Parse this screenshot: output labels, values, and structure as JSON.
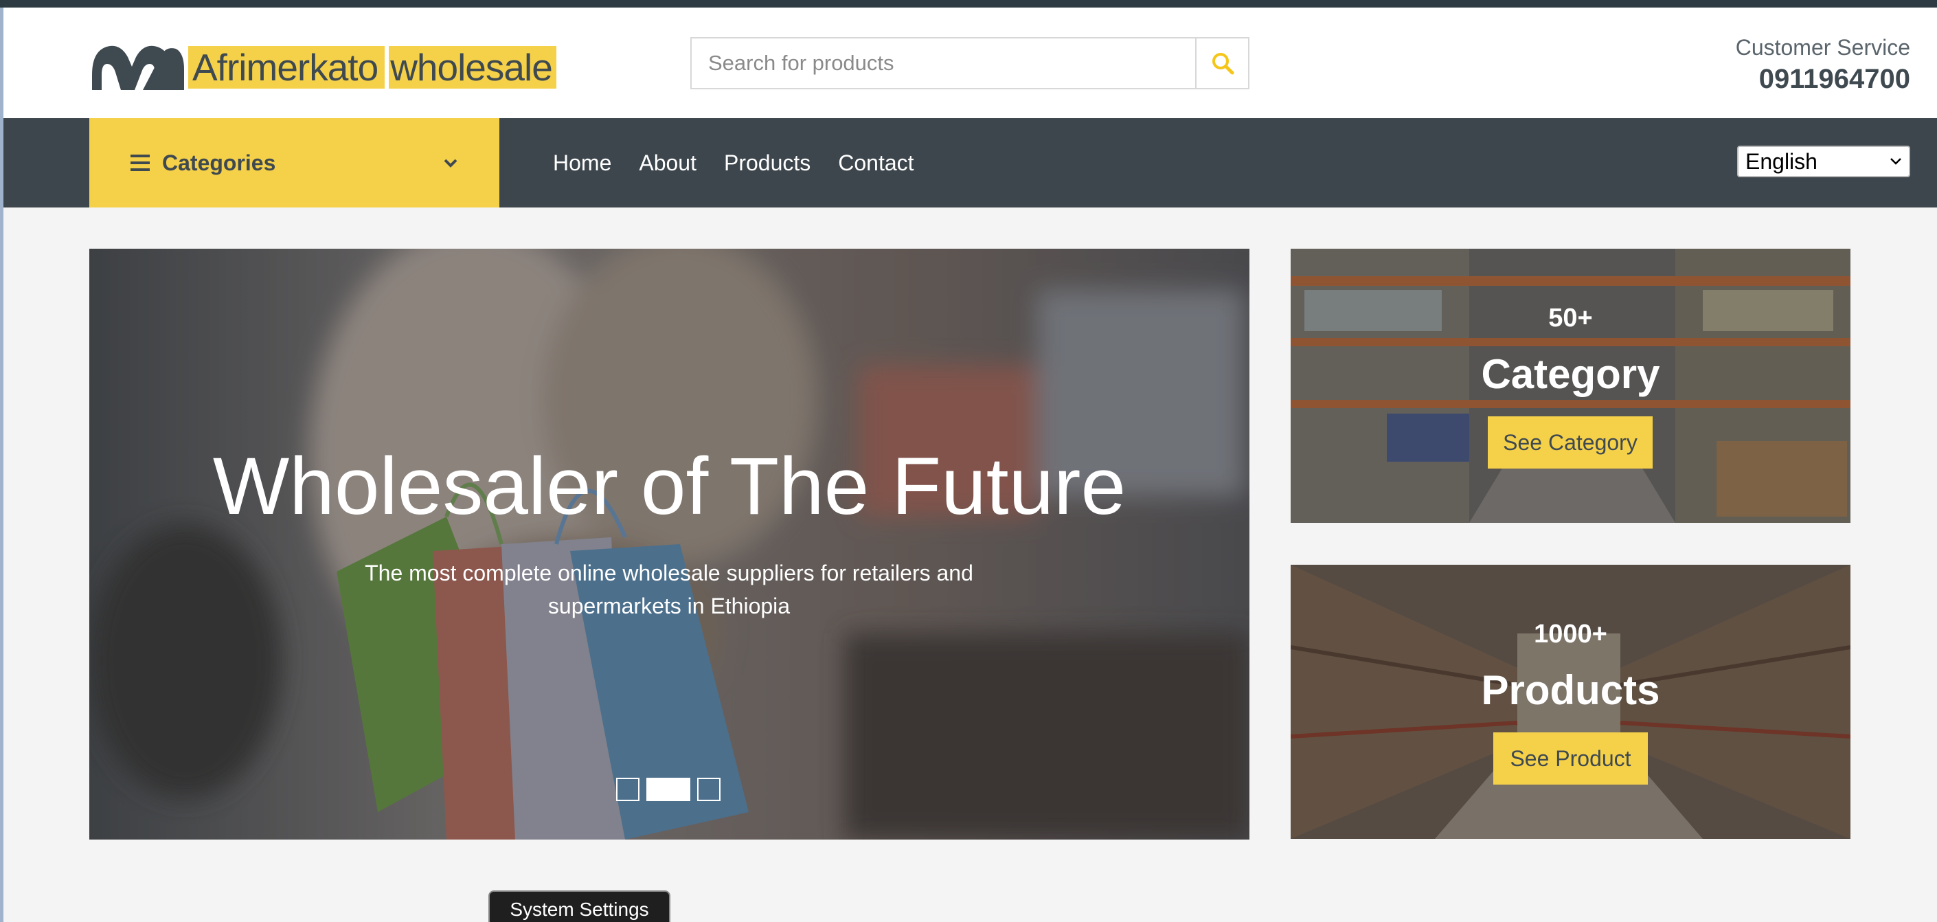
{
  "header": {
    "logo": {
      "word1": "Afrimerkato",
      "word2": "wholesale"
    },
    "search": {
      "placeholder": "Search for products",
      "value": ""
    },
    "customer_service": {
      "label": "Customer Service",
      "phone": "0911964700"
    }
  },
  "nav": {
    "categories_label": "Categories",
    "links": [
      "Home",
      "About",
      "Products",
      "Contact"
    ],
    "language": "English"
  },
  "hero": {
    "title": "Wholesaler of The Future",
    "subtitle_line1": "The most complete online wholesale suppliers for retailers and",
    "subtitle_line2": "supermarkets in Ethiopia",
    "slides": 3,
    "active_slide": 2
  },
  "promos": [
    {
      "count": "50+",
      "title": "Category",
      "button": "See Category"
    },
    {
      "count": "1000+",
      "title": "Products",
      "button": "See Product"
    }
  ],
  "system_settings_label": "System Settings",
  "colors": {
    "accent": "#f5d14a",
    "navbar": "#3d464d",
    "text_dark": "#3f4950"
  },
  "icons": {
    "menu": "hamburger-icon",
    "dropdown": "chevron-down-icon",
    "search": "search-icon"
  }
}
